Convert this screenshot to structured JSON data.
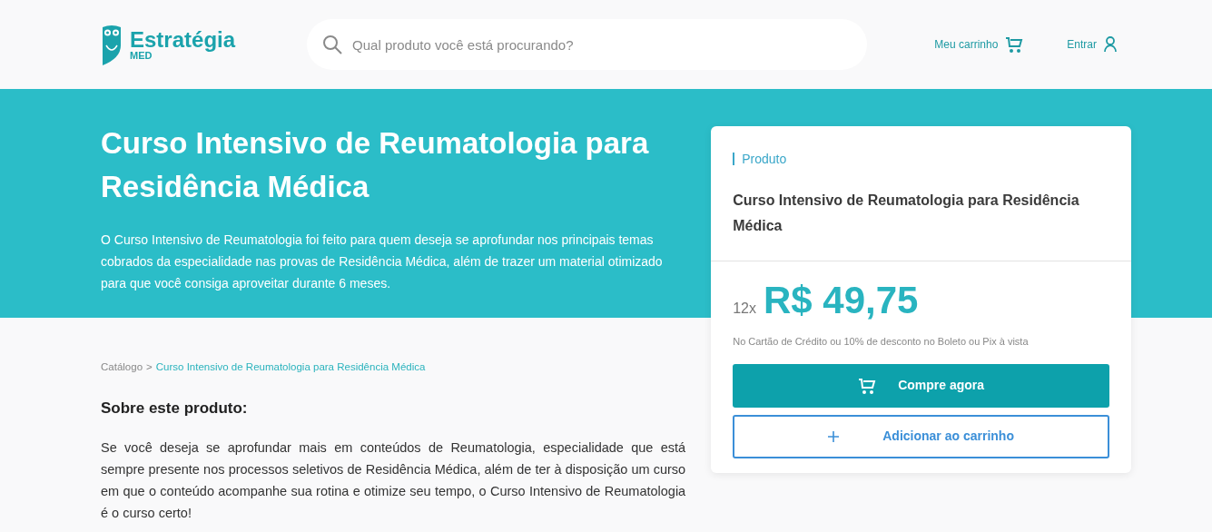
{
  "header": {
    "logo": {
      "name": "Estratégia",
      "sub": "MED"
    },
    "search": {
      "placeholder": "Qual produto você está procurando?"
    },
    "links": [
      {
        "label": "Meu carrinho",
        "kind": "cart"
      },
      {
        "label": "Entrar",
        "kind": "user"
      }
    ]
  },
  "hero": {
    "title": "Curso Intensivo de Reumatologia para Residência Médica",
    "description": "O Curso Intensivo de Reumatologia foi feito para quem deseja se aprofundar nos principais temas cobrados da especialidade nas provas de Residência Médica, além de trazer um material otimizado para que você consiga aproveitar durante 6 meses."
  },
  "breadcrumb": {
    "separator": ">",
    "items": [
      {
        "label": "Catálogo",
        "current": false
      },
      {
        "label": "Curso Intensivo de Reumatologia para Residência Médica",
        "current": true
      }
    ]
  },
  "about": {
    "heading": "Sobre este produto:",
    "text": "Se você deseja se aprofundar mais em conteúdos de Reumatologia, especialidade que está sempre presente nos processos seletivos de Residência Médica, além de ter à disposição um curso em que o conteúdo acompanhe sua rotina e otimize seu tempo, o Curso Intensivo de Reumatologia é o curso certo!"
  },
  "product_card": {
    "label": "Produto",
    "title": "Curso Intensivo de Reumatologia para Residência Médica",
    "installments": "12x",
    "price": "R$ 49,75",
    "note": "No Cartão de Crédito ou 10% de desconto no Boleto ou Pix à vista",
    "buttons": [
      {
        "label": "Compre agora",
        "kind": "primary"
      },
      {
        "label": "Adicionar ao carrinho",
        "kind": "outline"
      }
    ]
  }
}
